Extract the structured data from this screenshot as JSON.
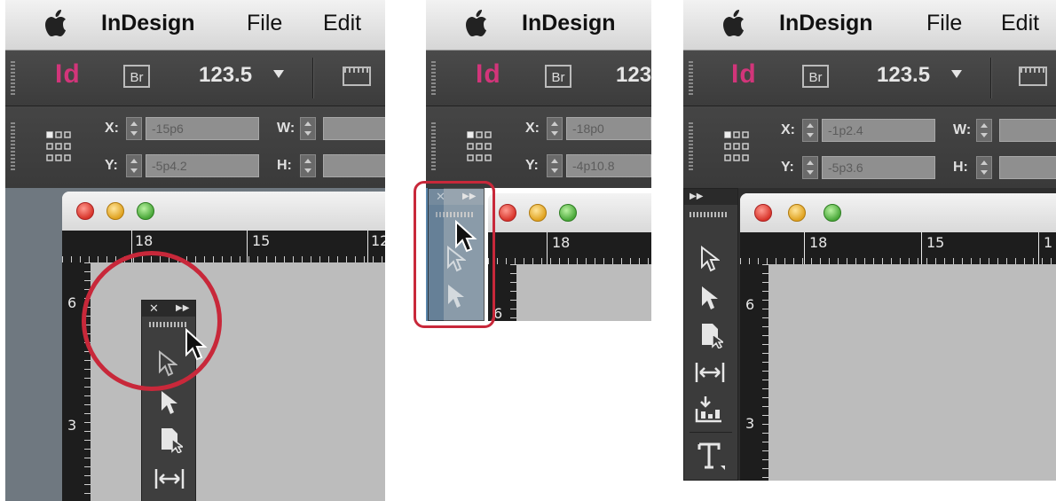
{
  "menubar": {
    "app": "InDesign",
    "file": "File",
    "edit": "Edit"
  },
  "app_bar": {
    "logo": "Id",
    "bridge": "Br",
    "zoom": "123.5"
  },
  "colors": {
    "id_pink": "#d2357a",
    "highlight_red": "#c8283a"
  },
  "panels": [
    {
      "x_label": "X:",
      "y_label": "Y:",
      "w_label": "W:",
      "h_label": "H:",
      "x_value": "-15p6",
      "y_value": "-5p4.2",
      "ruler_top": [
        "18",
        "15",
        "12"
      ],
      "ruler_left": [
        "6",
        "3"
      ]
    },
    {
      "x_label": "X:",
      "y_label": "Y:",
      "x_value": "-18p0",
      "y_value": "-4p10.8",
      "zoom_clip": "123",
      "ruler_top": [
        "18"
      ],
      "ruler_left": [
        "6"
      ]
    },
    {
      "x_label": "X:",
      "y_label": "Y:",
      "w_label": "W:",
      "h_label": "H:",
      "x_value": "-1p2.4",
      "y_value": "-5p3.6",
      "ruler_top": [
        "18",
        "15",
        "1"
      ],
      "ruler_left": [
        "6",
        "3"
      ]
    }
  ],
  "icons": [
    "apple-logo",
    "id-logo",
    "bridge-icon",
    "screen-mode-icon",
    "reference-point-icon",
    "selection-tool",
    "direct-selection-tool",
    "page-tool",
    "gap-tool",
    "content-collector-tool",
    "type-tool",
    "close-icon",
    "collapse-icon",
    "pointer-cursor"
  ]
}
